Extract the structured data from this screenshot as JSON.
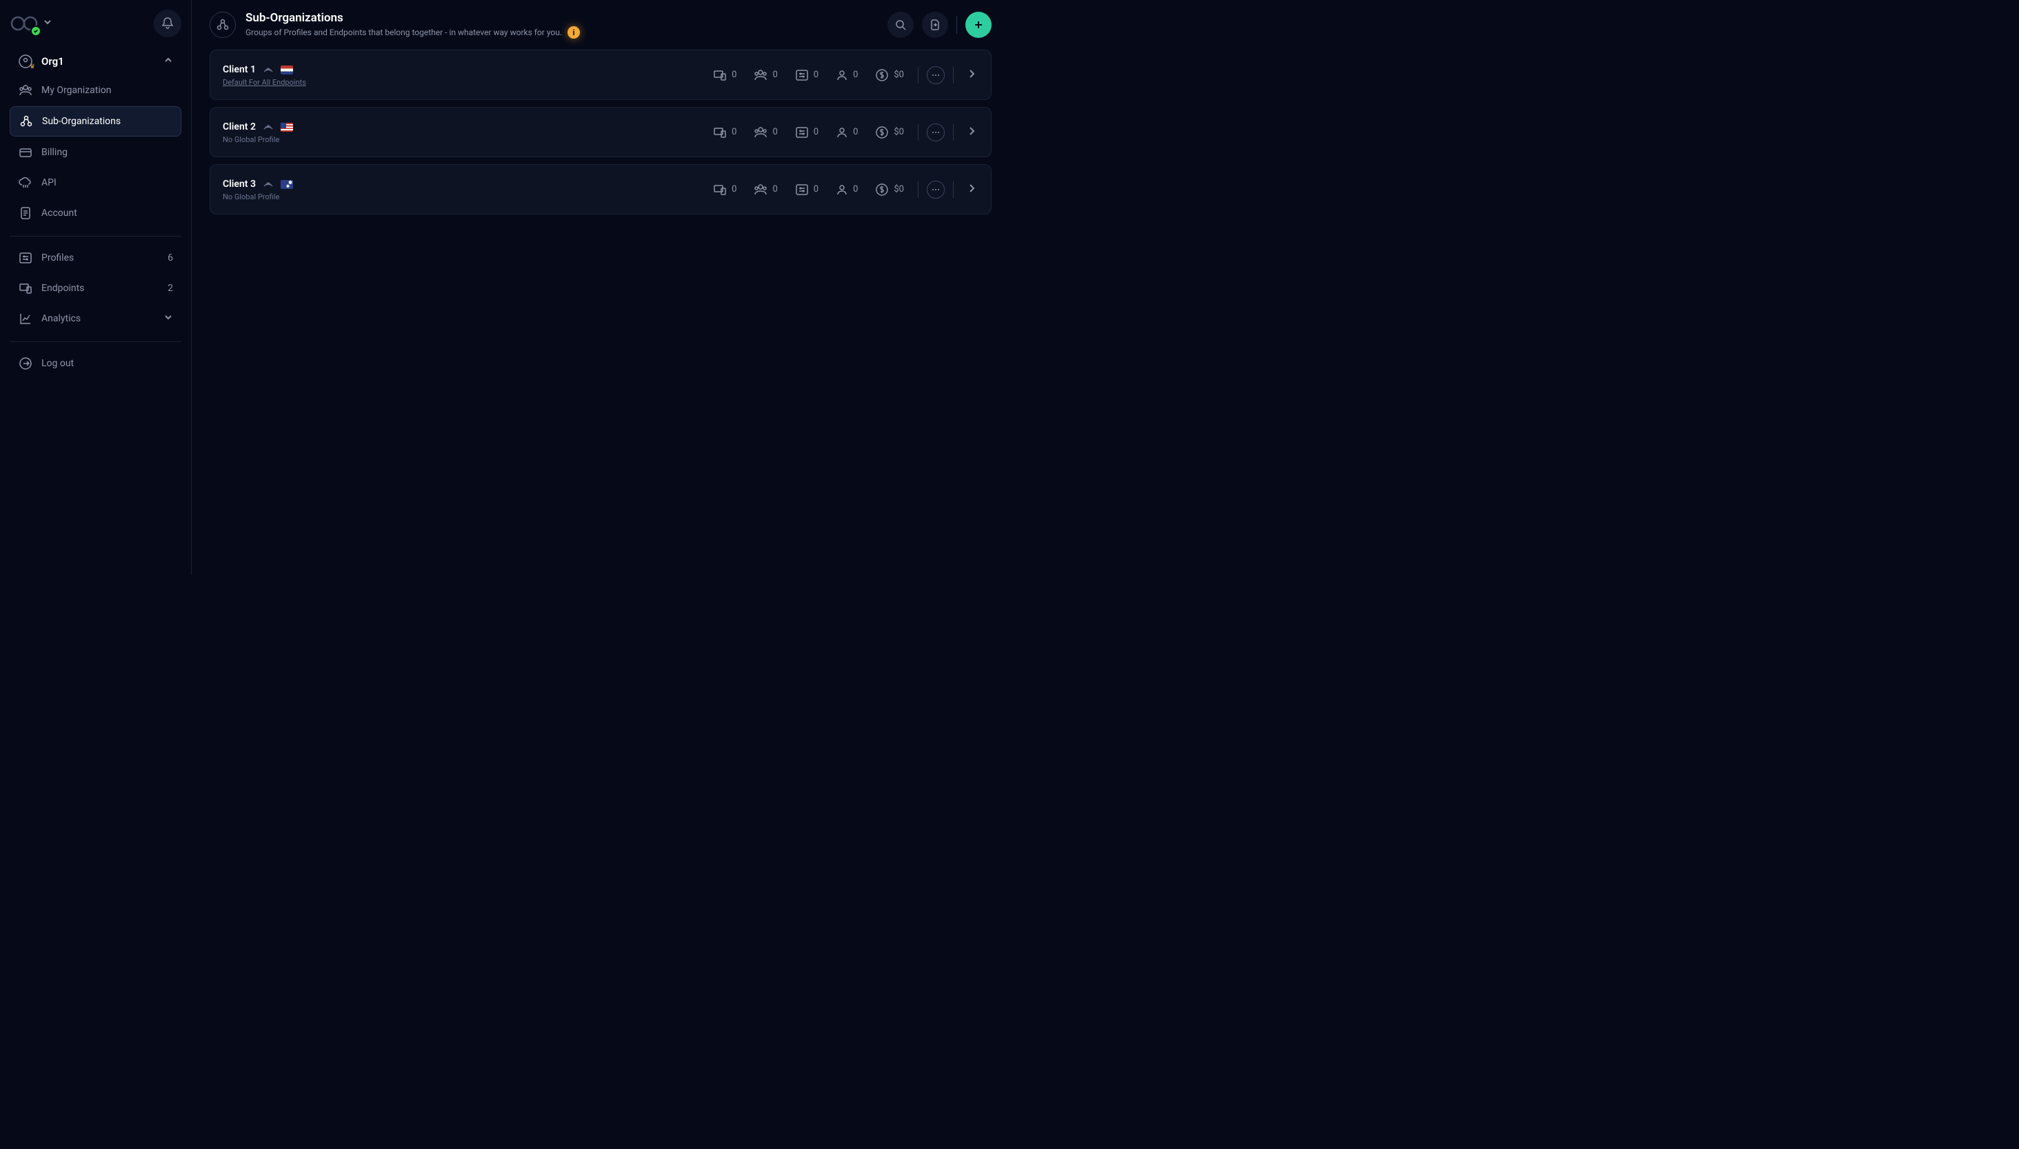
{
  "sidebar": {
    "org": {
      "name": "Org1"
    },
    "nav1": [
      {
        "label": "My Organization"
      },
      {
        "label": "Sub-Organizations"
      },
      {
        "label": "Billing"
      },
      {
        "label": "API"
      },
      {
        "label": "Account"
      }
    ],
    "nav2": [
      {
        "label": "Profiles",
        "count": "6"
      },
      {
        "label": "Endpoints",
        "count": "2"
      },
      {
        "label": "Analytics"
      }
    ],
    "nav3": [
      {
        "label": "Log out"
      }
    ]
  },
  "header": {
    "title": "Sub-Organizations",
    "subtitle": "Groups of Profiles and Endpoints that belong together - in whatever way works for you."
  },
  "clients": [
    {
      "name": "Client 1",
      "sub": "Default For All Endpoints",
      "link": true,
      "flag": "nl",
      "endpoints": "0",
      "groups": "0",
      "profiles": "0",
      "users": "0",
      "cost": "$0"
    },
    {
      "name": "Client 2",
      "sub": "No Global Profile",
      "link": false,
      "flag": "us",
      "endpoints": "0",
      "groups": "0",
      "profiles": "0",
      "users": "0",
      "cost": "$0"
    },
    {
      "name": "Client 3",
      "sub": "No Global Profile",
      "link": false,
      "flag": "au",
      "endpoints": "0",
      "groups": "0",
      "profiles": "0",
      "users": "0",
      "cost": "$0"
    }
  ]
}
